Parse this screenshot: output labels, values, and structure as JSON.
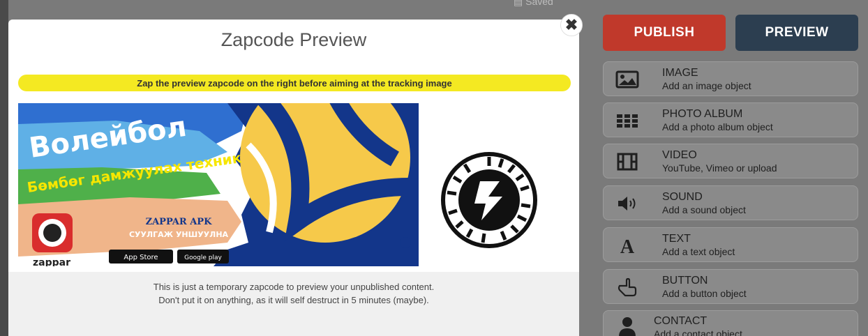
{
  "background": {
    "saved_label": "Saved"
  },
  "modal": {
    "title": "Zapcode Preview",
    "instruction": "Zap the preview zapcode on the right before aiming at the tracking image",
    "close_label": "✖",
    "tracking_image": {
      "headline": "Волейбол",
      "subline_1": "Бөмбөг дамжуулах техник",
      "subline_2": "",
      "app_title": "ZAPPAR APK",
      "app_sub": "СУУЛГАЖ УНШУУЛНА",
      "logo_text": "zappar",
      "app_store": "App Store",
      "google_play": "Google play"
    },
    "footer_line_1": "This is just a temporary zapcode to preview your unpublished content.",
    "footer_line_2": "Don't put it on anything, as it will self destruct in 5 minutes (maybe)."
  },
  "toolbar": {
    "publish_label": "PUBLISH",
    "preview_label": "PREVIEW"
  },
  "objects": [
    {
      "title": "IMAGE",
      "subtitle": "Add an image object",
      "icon": "image-icon"
    },
    {
      "title": "PHOTO ALBUM",
      "subtitle": "Add a photo album object",
      "icon": "grid-icon"
    },
    {
      "title": "VIDEO",
      "subtitle": "YouTube, Vimeo or upload",
      "icon": "film-icon"
    },
    {
      "title": "SOUND",
      "subtitle": "Add a sound object",
      "icon": "speaker-icon"
    },
    {
      "title": "TEXT",
      "subtitle": "Add a text object",
      "icon": "text-icon"
    },
    {
      "title": "BUTTON",
      "subtitle": "Add a button object",
      "icon": "pointer-hand-icon"
    },
    {
      "title": "CONTACT",
      "subtitle": "Add a contact object",
      "icon": "person-icon"
    }
  ],
  "colors": {
    "publish": "#c0392b",
    "preview": "#2c3e50",
    "instruction_bar": "#f4e922"
  }
}
